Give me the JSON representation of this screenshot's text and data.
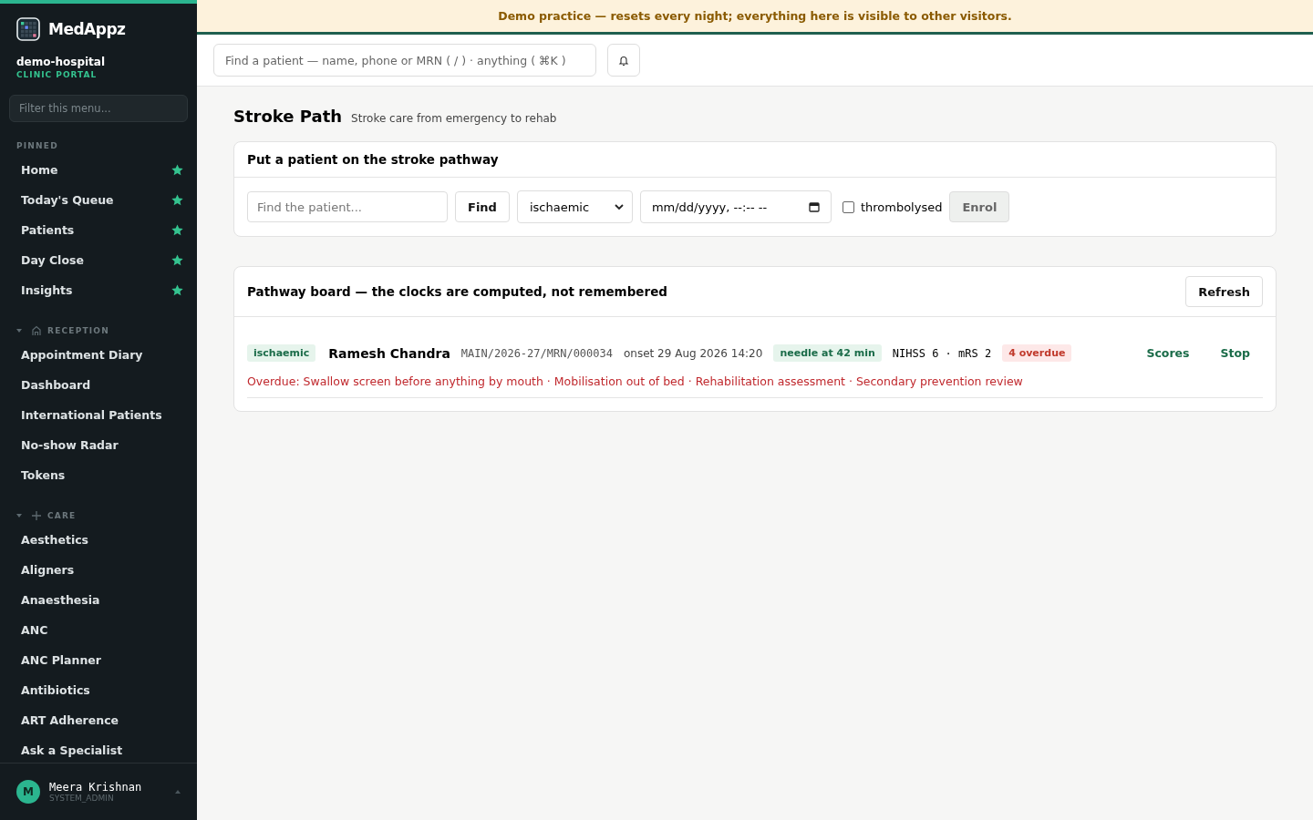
{
  "sidebar": {
    "brand": "MedAppz",
    "org": "demo-hospital",
    "portal": "CLINIC PORTAL",
    "filter": {
      "placeholder": "Filter this menu..."
    },
    "sections": [
      {
        "title": "PINNED",
        "kind": "pinned",
        "items": [
          {
            "label": "Home",
            "pinned": true
          },
          {
            "label": "Today's Queue",
            "pinned": true
          },
          {
            "label": "Patients",
            "pinned": true
          },
          {
            "label": "Day Close",
            "pinned": true
          },
          {
            "label": "Insights",
            "pinned": true
          }
        ]
      },
      {
        "title": "RECEPTION",
        "kind": "reception",
        "expanded": true,
        "items": [
          {
            "label": "Appointment Diary"
          },
          {
            "label": "Dashboard"
          },
          {
            "label": "International Patients"
          },
          {
            "label": "No-show Radar"
          },
          {
            "label": "Tokens"
          }
        ]
      },
      {
        "title": "CARE",
        "kind": "care",
        "expanded": true,
        "items": [
          {
            "label": "Aesthetics"
          },
          {
            "label": "Aligners"
          },
          {
            "label": "Anaesthesia"
          },
          {
            "label": "ANC"
          },
          {
            "label": "ANC Planner"
          },
          {
            "label": "Antibiotics"
          },
          {
            "label": "ART Adherence"
          },
          {
            "label": "Ask a Specialist"
          }
        ]
      }
    ],
    "user": {
      "initial": "M",
      "name": "Meera Krishnan",
      "role": "SYSTEM_ADMIN"
    }
  },
  "banner": "Demo practice — resets every night; everything here is visible to other visitors.",
  "search": {
    "placeholder": "Find a patient — name, phone or MRN ( / ) · anything ( ⌘K )"
  },
  "page": {
    "title": "Stroke Path",
    "subtitle": "Stroke care from emergency to rehab"
  },
  "enrol": {
    "title": "Put a patient on the stroke pathway",
    "patient": {
      "placeholder": "Find the patient..."
    },
    "find": "Find",
    "type": "ischaemic",
    "onset": {
      "placeholder": "mm/dd/yyyy, --:-- --"
    },
    "thrombolysed": {
      "label": "thrombolysed",
      "checked": false
    },
    "submit": {
      "label": "Enrol",
      "disabled": true
    }
  },
  "board": {
    "title": "Pathway board — the clocks are computed, not remembered",
    "refresh": "Refresh",
    "rows": [
      {
        "type": "ischaemic",
        "name": "Ramesh Chandra",
        "mrn": "MAIN/2026-27/MRN/000034",
        "onset": "onset 29 Aug 2026 14:20",
        "needle": "needle at 42 min",
        "scores": "NIHSS 6 · mRS 2",
        "overdue": "4 overdue",
        "actions": [
          "Scores",
          "Stop"
        ],
        "overdue_list": "Overdue: Swallow screen before anything by mouth · Mobilisation out of bed · Rehabilitation assessment · Secondary prevention review"
      }
    ]
  }
}
